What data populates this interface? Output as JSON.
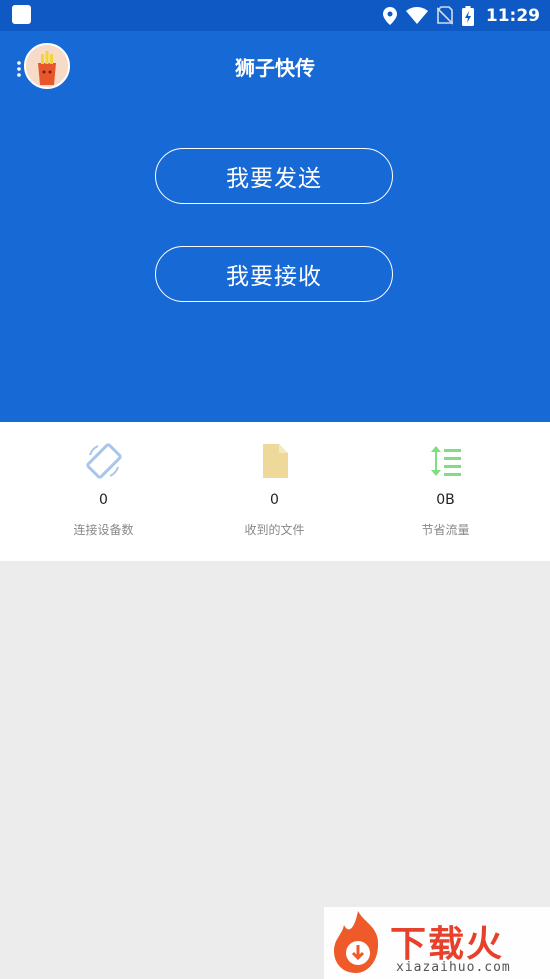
{
  "status_bar": {
    "time": "11:29",
    "icons": [
      "location-icon",
      "wifi-icon",
      "no-sim-icon",
      "battery-charging-icon"
    ]
  },
  "app_bar": {
    "title": "狮子快传",
    "background": "#1769d6"
  },
  "actions": {
    "send_label": "我要发送",
    "receive_label": "我要接收"
  },
  "stats": [
    {
      "icon": "screen-rotation-icon",
      "value": "0",
      "label": "连接设备数",
      "color": "#a7c6ea"
    },
    {
      "icon": "file-icon",
      "value": "0",
      "label": "收到的文件",
      "color": "#efd99a"
    },
    {
      "icon": "sort-list-icon",
      "value": "0B",
      "label": "节省流量",
      "color": "#7de07d"
    }
  ],
  "watermark": {
    "text": "下载火",
    "sub": "xiazaihuo.com"
  }
}
